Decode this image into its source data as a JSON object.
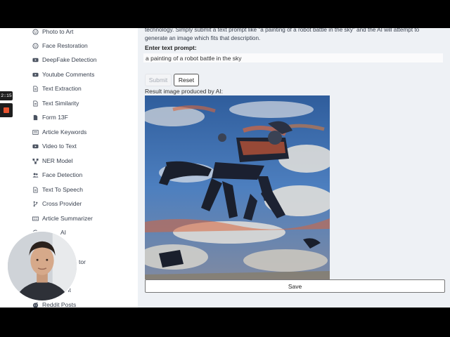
{
  "sidebar": {
    "items": [
      {
        "label": "Photo to Art",
        "icon": "smiley-icon"
      },
      {
        "label": "Face Restoration",
        "icon": "smiley-icon"
      },
      {
        "label": "DeepFake Detection",
        "icon": "youtube-icon"
      },
      {
        "label": "Youtube Comments",
        "icon": "youtube-icon"
      },
      {
        "label": "Text Extraction",
        "icon": "document-icon"
      },
      {
        "label": "Text Similarity",
        "icon": "document-icon"
      },
      {
        "label": "Form 13F",
        "icon": "file-icon"
      },
      {
        "label": "Article Keywords",
        "icon": "list-icon"
      },
      {
        "label": "Video to Text",
        "icon": "youtube-icon"
      },
      {
        "label": "NER Model",
        "icon": "network-icon"
      },
      {
        "label": "Face Detection",
        "icon": "users-icon"
      },
      {
        "label": "Text To Speech",
        "icon": "document-icon"
      },
      {
        "label": "Cross Provider",
        "icon": "branch-icon"
      },
      {
        "label": "Article Summarizer",
        "icon": "keyboard-icon"
      },
      {
        "label": "AI",
        "icon": "smiley-icon"
      },
      {
        "label": "tor",
        "icon": "smiley-icon"
      },
      {
        "label": "ment",
        "icon": "document-icon"
      },
      {
        "label": "Reddit Posts",
        "icon": "reddit-icon"
      }
    ]
  },
  "main": {
    "description": "technology. Simply submit a text prompt like \"a painting of a robot battle in the sky\" and the AI will attempt to generate an image which fits that description.",
    "prompt_label": "Enter text prompt:",
    "prompt_value": "a painting of a robot battle in the sky",
    "submit_label": "Submit",
    "reset_label": "Reset",
    "result_label": "Result image produced by AI:",
    "save_label": "Save"
  },
  "recorder": {
    "timer": "2:15"
  },
  "colors": {
    "stop": "#e8532f",
    "background": "#eef1f5"
  }
}
